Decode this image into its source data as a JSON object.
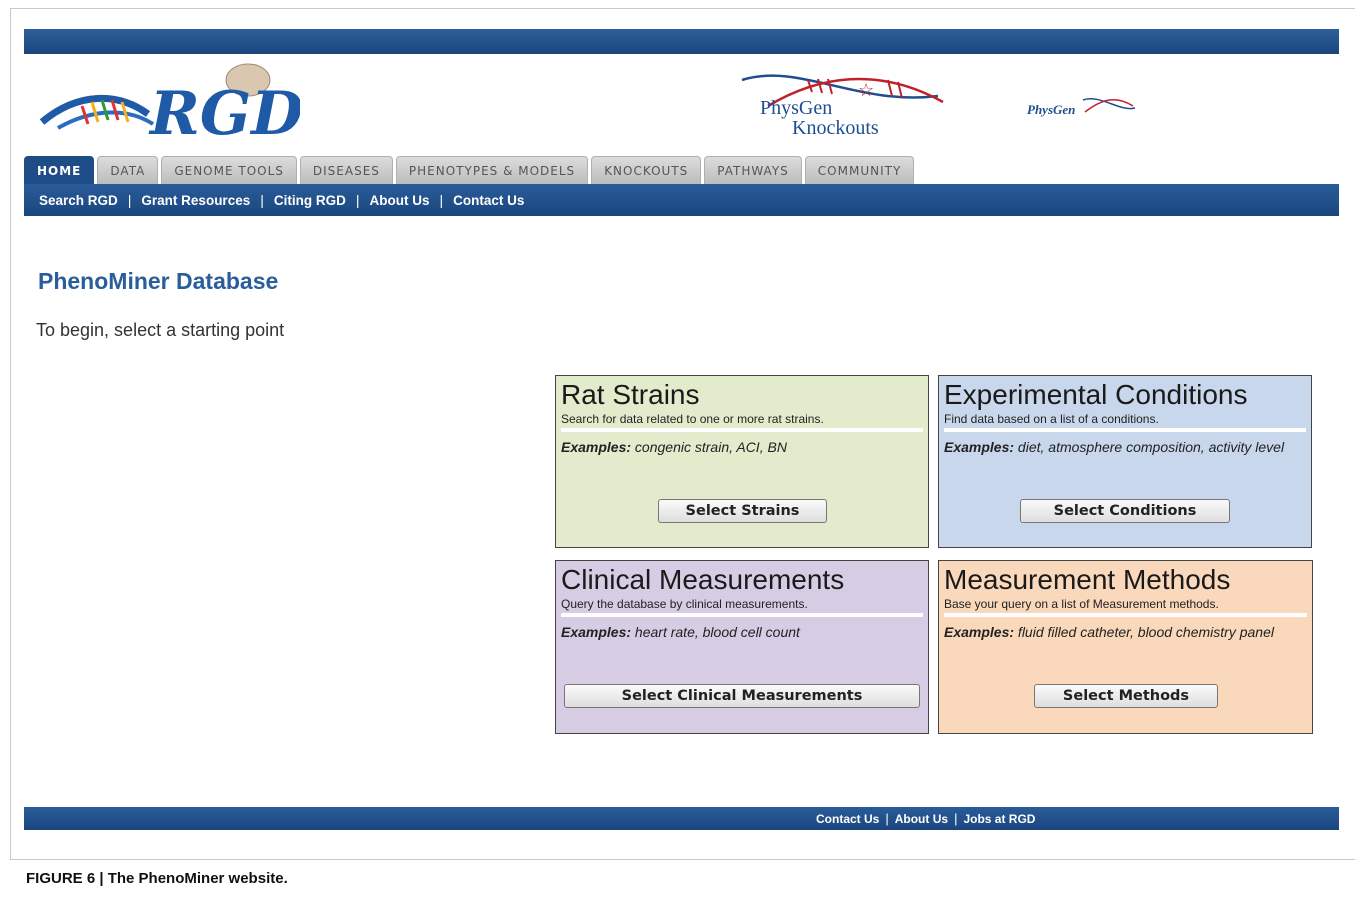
{
  "colors": {
    "brand_blue": "#1d4c86",
    "title_blue": "#2a5d9a",
    "card_strains": "#e3ebcd",
    "card_conditions": "#c9d7ec",
    "card_clinical": "#d6cde5",
    "card_methods": "#fad8bb"
  },
  "header": {
    "logo_rgd": "RGD",
    "logo_physgen_line1": "PhysGen",
    "logo_physgen_line2": "Knockouts",
    "logo_physgen_small": "PhysGen"
  },
  "tabs": [
    {
      "label": "HOME",
      "active": true
    },
    {
      "label": "DATA"
    },
    {
      "label": "GENOME TOOLS"
    },
    {
      "label": "DISEASES"
    },
    {
      "label": "PHENOTYPES & MODELS"
    },
    {
      "label": "KNOCKOUTS"
    },
    {
      "label": "PATHWAYS"
    },
    {
      "label": "COMMUNITY"
    }
  ],
  "subnav": [
    "Search RGD",
    "Grant Resources",
    "Citing RGD",
    "About Us",
    "Contact Us"
  ],
  "main": {
    "title": "PhenoMiner Database",
    "intro": "To begin, select a starting point"
  },
  "cards": [
    {
      "title": "Rat Strains",
      "subtitle": "Search for data related to one or more rat strains.",
      "examples_label": "Examples:",
      "examples": " congenic strain, ACI, BN",
      "button": "Select Strains"
    },
    {
      "title": "Experimental Conditions",
      "subtitle": "Find data based on a list of a conditions.",
      "examples_label": "Examples:",
      "examples": " diet, atmosphere composition, activity level",
      "button": "Select Conditions"
    },
    {
      "title": "Clinical Measurements",
      "subtitle": "Query the database by clinical measurements.",
      "examples_label": "Examples:",
      "examples": " heart rate, blood cell count",
      "button": "Select Clinical Measurements"
    },
    {
      "title": "Measurement Methods",
      "subtitle": "Base your query on a list of Measurement methods.",
      "examples_label": "Examples:",
      "examples": " fluid filled catheter, blood chemistry panel",
      "button": "Select Methods"
    }
  ],
  "footer": [
    "Contact Us",
    "About Us",
    "Jobs at RGD"
  ],
  "caption": "FIGURE 6 | The PhenoMiner website."
}
